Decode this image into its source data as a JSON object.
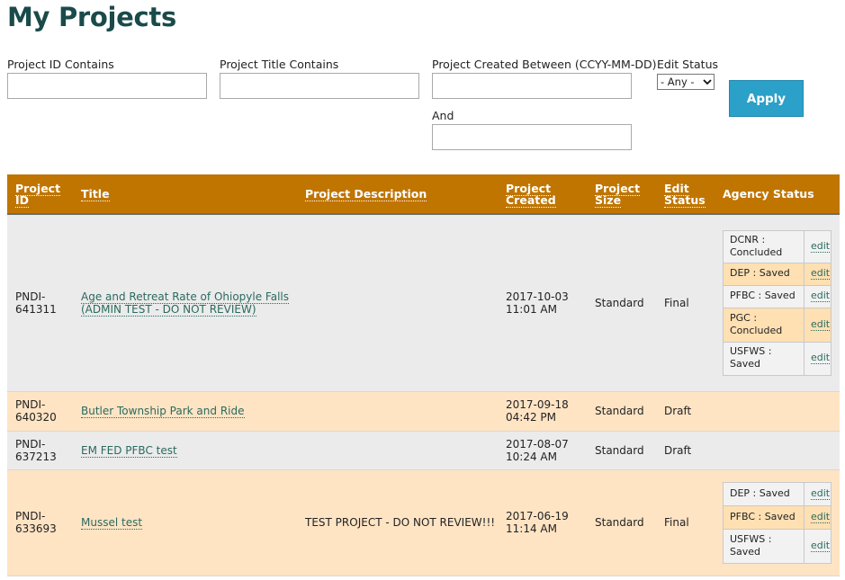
{
  "page": {
    "title": "My Projects"
  },
  "filters": {
    "project_id_label": "Project ID Contains",
    "project_id_value": "",
    "project_title_label": "Project Title Contains",
    "project_title_value": "",
    "created_between_label": "Project Created Between (CCYY-MM-DD)",
    "created_from_value": "",
    "and_label": "And",
    "created_to_value": "",
    "edit_status_label": "Edit Status",
    "edit_status_selected": "- Any -",
    "apply_label": "Apply"
  },
  "table": {
    "headers": {
      "project_id": "Project ID",
      "title": "Title",
      "description": "Project Description",
      "created": "Project Created",
      "size": "Project Size",
      "edit_status": "Edit Status",
      "agency_status": "Agency Status"
    },
    "rows": [
      {
        "id": "PNDI-641311",
        "title": "Age and Retreat Rate of Ohiopyle Falls (ADMIN TEST - DO NOT REVIEW)",
        "description": "",
        "created": "2017-10-03 11:01 AM",
        "size": "Standard",
        "edit_status": "Final",
        "agencies": [
          {
            "status": "DCNR : Concluded",
            "edit": "edit"
          },
          {
            "status": "DEP : Saved",
            "edit": "edit"
          },
          {
            "status": "PFBC : Saved",
            "edit": "edit"
          },
          {
            "status": "PGC : Concluded",
            "edit": "edit"
          },
          {
            "status": "USFWS : Saved",
            "edit": "edit"
          }
        ]
      },
      {
        "id": "PNDI-640320",
        "title": "Butler Township Park and Ride",
        "description": "",
        "created": "2017-09-18 04:42 PM",
        "size": "Standard",
        "edit_status": "Draft",
        "agencies": []
      },
      {
        "id": "PNDI-637213",
        "title": "EM FED PFBC test",
        "description": "",
        "created": "2017-08-07 10:24 AM",
        "size": "Standard",
        "edit_status": "Draft",
        "agencies": []
      },
      {
        "id": "PNDI-633693",
        "title": "Mussel test",
        "description": "TEST PROJECT - DO NOT REVIEW!!!",
        "created": "2017-06-19 11:14 AM",
        "size": "Standard",
        "edit_status": "Final",
        "agencies": [
          {
            "status": "DEP : Saved",
            "edit": "edit"
          },
          {
            "status": "PFBC : Saved",
            "edit": "edit"
          },
          {
            "status": "USFWS : Saved",
            "edit": "edit"
          }
        ]
      }
    ]
  },
  "colors": {
    "header_bg": "#c07500",
    "row_gray": "#ebebeb",
    "row_peach": "#ffe4c4",
    "link": "#2a6a5e",
    "apply_bg": "#2ba0c8",
    "title": "#1a4a4a"
  },
  "icons": {
    "select_arrow": "chevron-down-icon"
  }
}
